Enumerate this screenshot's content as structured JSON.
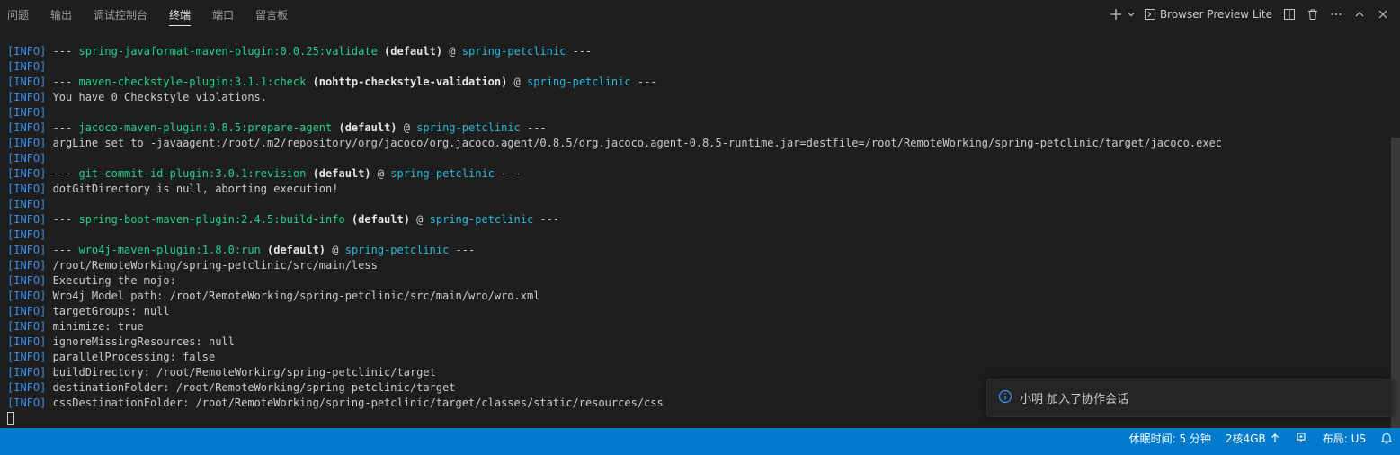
{
  "tabs": [
    {
      "label": "问题",
      "active": false
    },
    {
      "label": "输出",
      "active": false
    },
    {
      "label": "调试控制台",
      "active": false
    },
    {
      "label": "终端",
      "active": true
    },
    {
      "label": "端口",
      "active": false
    },
    {
      "label": "留言板",
      "active": false
    }
  ],
  "actions": {
    "new_terminal_icon": "plus-icon",
    "dropdown_icon": "chevron-down-icon",
    "launch_label": "Browser Preview Lite",
    "split_icon": "split-icon",
    "kill_icon": "trash-icon",
    "more_icon": "more-icon",
    "maximize_icon": "chevron-up-icon",
    "close_icon": "close-icon"
  },
  "colors": {
    "tag": "#3b8eea",
    "plugin": "#23d18b",
    "project": "#29b8db",
    "text": "#cccccc",
    "status_bar": "#007acc"
  },
  "terminal_lines": [
    {
      "tag": "[INFO]",
      "sep": " --- ",
      "plugin": "spring-javaformat-maven-plugin:0.0.25:validate",
      "exec": " (default)",
      "at": " @ ",
      "project": "spring-petclinic",
      "tail": " ---"
    },
    {
      "tag": "[INFO]"
    },
    {
      "tag": "[INFO]",
      "sep": " --- ",
      "plugin": "maven-checkstyle-plugin:3.1.1:check",
      "exec": " (nohttp-checkstyle-validation)",
      "at": " @ ",
      "project": "spring-petclinic",
      "tail": " ---"
    },
    {
      "tag": "[INFO]",
      "text": " You have 0 Checkstyle violations."
    },
    {
      "tag": "[INFO]"
    },
    {
      "tag": "[INFO]",
      "sep": " --- ",
      "plugin": "jacoco-maven-plugin:0.8.5:prepare-agent",
      "exec": " (default)",
      "at": " @ ",
      "project": "spring-petclinic",
      "tail": " ---"
    },
    {
      "tag": "[INFO]",
      "text": " argLine set to -javaagent:/root/.m2/repository/org/jacoco/org.jacoco.agent/0.8.5/org.jacoco.agent-0.8.5-runtime.jar=destfile=/root/RemoteWorking/spring-petclinic/target/jacoco.exec"
    },
    {
      "tag": "[INFO]"
    },
    {
      "tag": "[INFO]",
      "sep": " --- ",
      "plugin": "git-commit-id-plugin:3.0.1:revision",
      "exec": " (default)",
      "at": " @ ",
      "project": "spring-petclinic",
      "tail": " ---"
    },
    {
      "tag": "[INFO]",
      "text": " dotGitDirectory is null, aborting execution!"
    },
    {
      "tag": "[INFO]"
    },
    {
      "tag": "[INFO]",
      "sep": " --- ",
      "plugin": "spring-boot-maven-plugin:2.4.5:build-info",
      "exec": " (default)",
      "at": " @ ",
      "project": "spring-petclinic",
      "tail": " ---"
    },
    {
      "tag": "[INFO]"
    },
    {
      "tag": "[INFO]",
      "sep": " --- ",
      "plugin": "wro4j-maven-plugin:1.8.0:run",
      "exec": " (default)",
      "at": " @ ",
      "project": "spring-petclinic",
      "tail": " ---"
    },
    {
      "tag": "[INFO]",
      "text": " /root/RemoteWorking/spring-petclinic/src/main/less"
    },
    {
      "tag": "[INFO]",
      "text": " Executing the mojo:"
    },
    {
      "tag": "[INFO]",
      "text": " Wro4j Model path: /root/RemoteWorking/spring-petclinic/src/main/wro/wro.xml"
    },
    {
      "tag": "[INFO]",
      "text": " targetGroups: null"
    },
    {
      "tag": "[INFO]",
      "text": " minimize: true"
    },
    {
      "tag": "[INFO]",
      "text": " ignoreMissingResources: null"
    },
    {
      "tag": "[INFO]",
      "text": " parallelProcessing: false"
    },
    {
      "tag": "[INFO]",
      "text": " buildDirectory: /root/RemoteWorking/spring-petclinic/target"
    },
    {
      "tag": "[INFO]",
      "text": " destinationFolder: /root/RemoteWorking/spring-petclinic/target"
    },
    {
      "tag": "[INFO]",
      "text": " cssDestinationFolder: /root/RemoteWorking/spring-petclinic/target/classes/static/resources/css"
    }
  ],
  "toast": {
    "icon": "info-icon",
    "message": "小明 加入了协作会话"
  },
  "status_bar": {
    "sleep_time": "休眠时间: 5 分钟",
    "resources": "2核4GB",
    "resources_icon": "arrow-up-icon",
    "network_icon": "remote-network-icon",
    "layout": "布局: US",
    "bell_icon": "bell-icon"
  }
}
